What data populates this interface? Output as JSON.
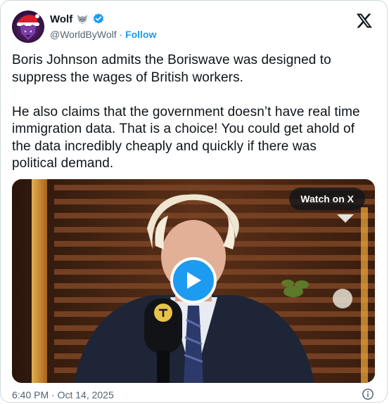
{
  "author": {
    "display_name": "Wolf",
    "handle": "@WorldByWolf",
    "separator": "·",
    "follow_label": "Follow",
    "emoji_icon": "wolf-emoji-icon",
    "verified_icon": "verified-badge-icon",
    "verified_color": "#1d9bf0"
  },
  "tweet": {
    "text": "Boris Johnson admits the Boriswave was designed to\nsuppress the wages of British workers.\n\nHe also claims that the government doesn’t have real time\nimmigration data. That is a choice! You could get ahold of\nthe data incredibly cheaply and quickly if there was\npolitical demand."
  },
  "media": {
    "watch_label": "Watch on X",
    "play_icon": "play-icon"
  },
  "footer": {
    "timestamp": "6:40 PM · Oct 14, 2025",
    "info_icon": "info-icon"
  },
  "colors": {
    "accent": "#1d9bf0",
    "text": "#0f1419",
    "muted": "#536471",
    "border": "#cfd9de"
  }
}
